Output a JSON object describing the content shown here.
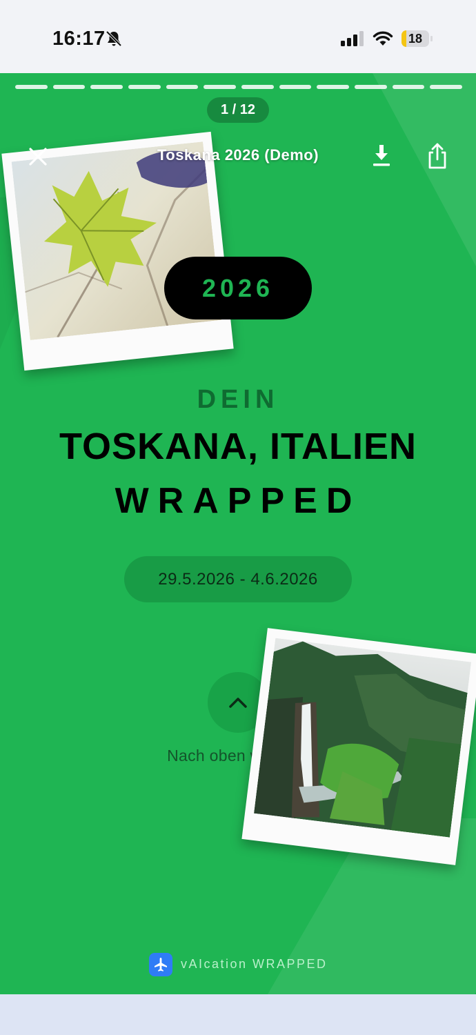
{
  "status_bar": {
    "time": "16:17",
    "battery_level": "18",
    "battery_fraction": 0.18,
    "icons": [
      "bell-slash-icon",
      "cellular-signal-icon",
      "wifi-icon",
      "battery-icon"
    ]
  },
  "story": {
    "progress": {
      "segments": 12,
      "current": 1
    },
    "counter": "1 / 12",
    "title": "Toskana 2026 (Demo)",
    "year": "2026",
    "dein": "DEIN",
    "place": "TOSKANA, ITALIEN",
    "wrapped": "WRAPPED",
    "date_range": "29.5.2026 - 4.6.2026",
    "swipe_hint": "Nach oben wischen",
    "brand": "vAIcation WRAPPED",
    "icons": [
      "close-icon",
      "download-icon",
      "share-icon",
      "chevron-up-icon",
      "airplane-icon"
    ]
  },
  "colors": {
    "background": "#1fb553",
    "dark_accent": "#0f6b31",
    "pill": "#000000",
    "brand_icon": "#2f7cf6"
  }
}
